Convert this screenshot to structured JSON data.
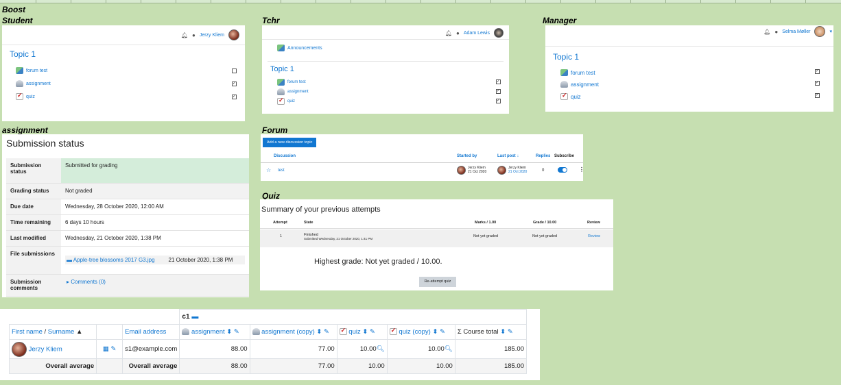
{
  "labels": {
    "boost": "Boost",
    "student": "Student",
    "tchr": "Tchr",
    "manager": "Manager",
    "assignment": "assignment",
    "forum": "Forum",
    "quiz": "Quiz"
  },
  "student": {
    "user": "Jerzy Kliem",
    "topic": "Topic 1",
    "items": [
      "forum test",
      "assignment",
      "quiz"
    ]
  },
  "tchr": {
    "user": "Adam Lewis",
    "announcements": "Announcements",
    "topic": "Topic 1",
    "items": [
      "forum test",
      "assignment",
      "quiz"
    ]
  },
  "manager": {
    "user": "Selma Møller",
    "topic": "Topic 1",
    "items": [
      "forum test",
      "assignment",
      "quiz"
    ]
  },
  "submission": {
    "title": "Submission status",
    "rows": [
      {
        "h": "Submission status",
        "v": "Submitted for grading"
      },
      {
        "h": "Grading status",
        "v": "Not graded"
      },
      {
        "h": "Due date",
        "v": "Wednesday, 28 October 2020, 12:00 AM"
      },
      {
        "h": "Time remaining",
        "v": "6 days 10 hours"
      },
      {
        "h": "Last modified",
        "v": "Wednesday, 21 October 2020, 1:38 PM"
      },
      {
        "h": "File submissions",
        "file": "Apple-tree blossoms 2017 G3.jpg",
        "date": "21 October 2020, 1:38 PM"
      },
      {
        "h": "Submission comments",
        "v": "Comments (0)"
      }
    ]
  },
  "forum": {
    "button": "Add a new discussion topic",
    "cols": [
      "Discussion",
      "Started by",
      "Last post ↓",
      "Replies",
      "Subscribe"
    ],
    "row": {
      "topic": "test",
      "started_name": "Jerzy Kliem",
      "started_date": "21 Oct 2020",
      "last_name": "Jerzy Kliem",
      "last_date": "21 Oct 2020",
      "replies": "0"
    }
  },
  "quiz": {
    "title": "Summary of your previous attempts",
    "cols": [
      "Attempt",
      "State",
      "Marks / 1.00",
      "Grade / 10.00",
      "Review"
    ],
    "row": {
      "attempt": "1",
      "state": "Finished",
      "submitted": "Submitted Wednesday, 21 October 2020, 1:41 PM",
      "marks": "Not yet graded",
      "grade": "Not yet graded",
      "review": "Review"
    },
    "highest": "Highest grade: Not yet graded / 10.00.",
    "reattempt": "Re-attempt quiz"
  },
  "grader": {
    "category": "c1",
    "first_name": "First name",
    "slash": " / ",
    "surname": "Surname",
    "email_header": "Email address",
    "cols": [
      "assignment",
      "assignment (copy)",
      "quiz",
      "quiz (copy)",
      "Course total"
    ],
    "user": {
      "name": "Jerzy Kliem",
      "email": "s1@example.com",
      "values": [
        "88.00",
        "77.00",
        "10.00",
        "10.00",
        "185.00"
      ]
    },
    "avg_label": "Overall average",
    "avg": [
      "88.00",
      "77.00",
      "10.00",
      "10.00",
      "185.00"
    ]
  }
}
